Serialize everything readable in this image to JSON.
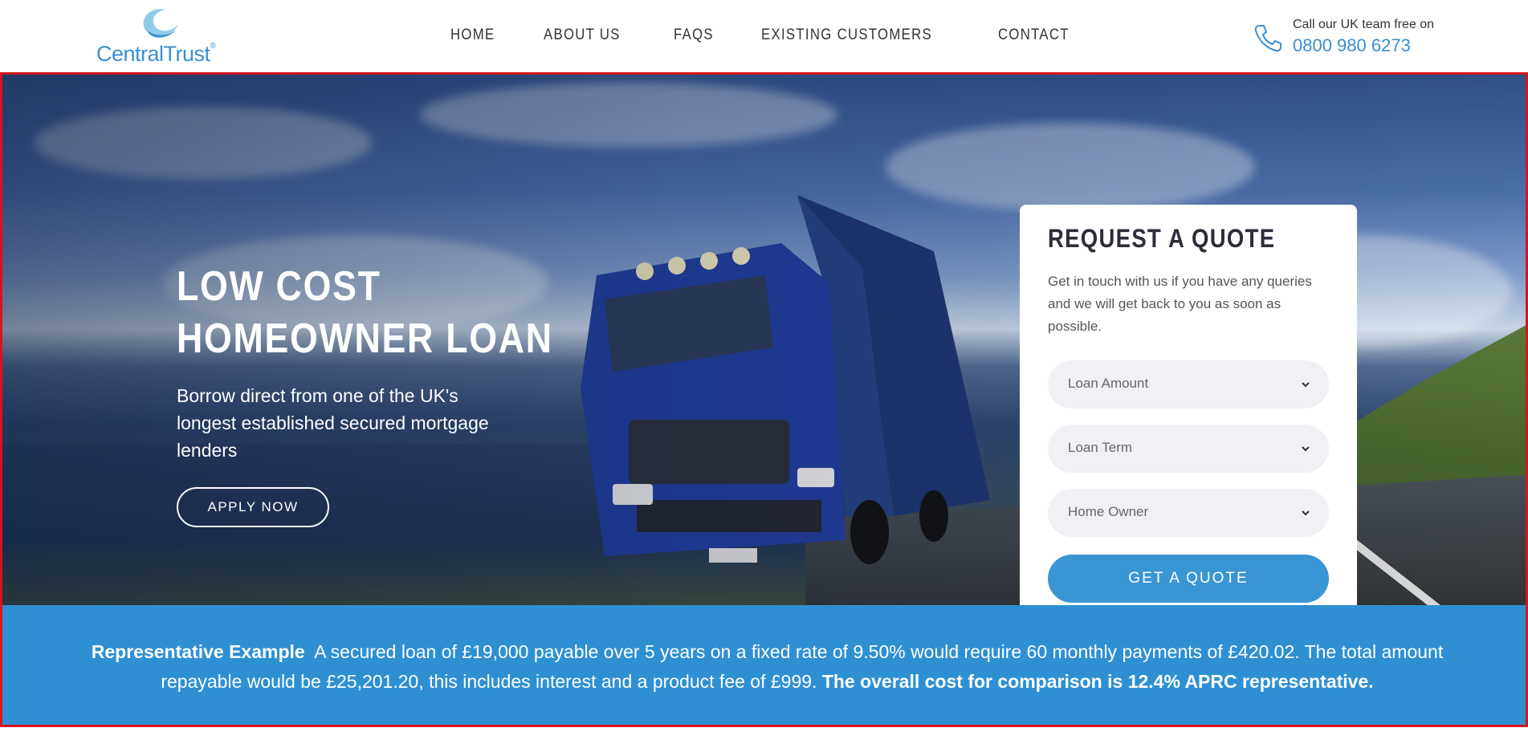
{
  "header": {
    "logo_text": "CentralTrust",
    "logo_mark": "®",
    "nav": [
      "HOME",
      "ABOUT US",
      "FAQS",
      "EXISTING CUSTOMERS",
      "CONTACT"
    ],
    "phone_label": "Call our UK team free on",
    "phone_number": "0800 980 6273"
  },
  "hero": {
    "title_line1": "LOW COST",
    "title_line2": "HOMEOWNER LOAN",
    "subtitle": "Borrow direct from one of the UK's longest established secured mortgage lenders",
    "apply_label": "APPLY NOW"
  },
  "quote": {
    "title": "REQUEST A QUOTE",
    "description": "Get in touch with us if you have any queries and we will get back to you as soon as possible.",
    "selects": [
      "Loan Amount",
      "Loan Term",
      "Home Owner"
    ],
    "button_label": "GET A QUOTE"
  },
  "representative": {
    "heading": "Representative Example",
    "body": "A secured loan of £19,000 payable over 5 years on a fixed rate of 9.50% would require 60 monthly payments of £420.02. The total amount repayable would be £25,201.20, this includes interest and a product fee of £999.",
    "emphasis": "The overall cost for comparison is 12.4% APRC representative."
  },
  "colors": {
    "brand_blue": "#3a95d4",
    "band_blue": "#2e90d3",
    "highlight_red": "#d7141d"
  },
  "icons": {
    "logo": "crescent-logo-icon",
    "phone": "phone-icon",
    "select_chevron": "chevron-down-icon"
  }
}
